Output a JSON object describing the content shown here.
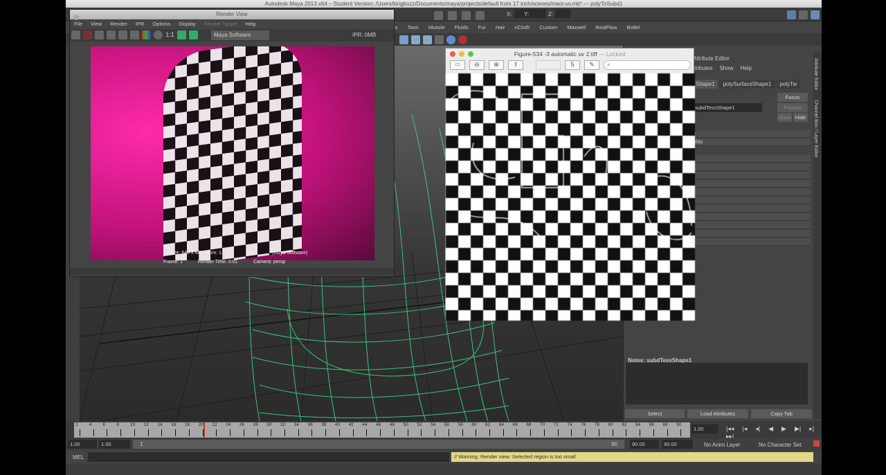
{
  "window_title": "Autodesk Maya 2013 x64 – Student Version: /Users/kingbuzz/Documents/maya/projects/default from 17 inch/scenes/maoi-uv.mb*  ---  polyToSubd1",
  "toolbar": {
    "x_label": "X:",
    "y_label": "Y:",
    "z_label": "Z:"
  },
  "shelf_tabs": [
    "cts",
    "Toon",
    "Muscle",
    "Fluids",
    "Fur",
    "Hair",
    "nCloth",
    "Custom",
    "Maxwell",
    "RealFlow",
    "Bullet"
  ],
  "render_view": {
    "title": "Render View",
    "menu": [
      "File",
      "View",
      "Render",
      "IPR",
      "Options",
      "Display",
      "Render Target",
      "Help"
    ],
    "ratio": "1:1",
    "renderer": "Maya Software",
    "ipr": "IPR: 0MB",
    "info_line1": "size: 640 x 480 zoom: 1.000",
    "info_renderer": "(Maya Software)",
    "frame": "Frame: 1",
    "render_time": "Render Time: 0:01",
    "camera": "Camera: persp"
  },
  "figure": {
    "title": "Figure-534 -3 automatic uv 2.tiff",
    "locked": "— Locked",
    "rotate": "5"
  },
  "attribute_editor": {
    "title": "Attribute Editor",
    "menu": [
      "ttributes",
      "Show",
      "Help"
    ],
    "tabs": [
      "Shape1",
      "polySurfaceShape1",
      "polyTw"
    ],
    "node_name": "subdTessShape1",
    "focus": "Focus",
    "presets": "Presets",
    "show": "Show",
    "hide": "Hide",
    "sections": [
      "s",
      "play"
    ],
    "notes": "Notes:  subdTessShape1",
    "buttons": [
      "Select",
      "Load Attributes",
      "Copy Tab"
    ]
  },
  "side_tabs": [
    "Attribute Editor",
    "Channel Box / Layer Editor"
  ],
  "timeline": {
    "ticks": [
      "2",
      "4",
      "6",
      "8",
      "10",
      "12",
      "14",
      "16",
      "18",
      "20",
      "22",
      "24",
      "26",
      "28",
      "30",
      "32",
      "34",
      "36",
      "38",
      "40",
      "42",
      "44",
      "46",
      "48",
      "50",
      "52",
      "54",
      "56",
      "58",
      "60",
      "62",
      "64",
      "66",
      "68",
      "70",
      "72",
      "74",
      "76",
      "78",
      "80",
      "82",
      "84",
      "86",
      "88",
      "90"
    ],
    "current_frame": "1.00",
    "playback": [
      "|◂◂",
      "|◂",
      "◂|",
      "◀",
      "▶",
      "▶|",
      "▸|",
      "▸▸|"
    ]
  },
  "range": {
    "start": "1.00",
    "inner_start": "1.00",
    "slider_start": "1",
    "slider_end": "90",
    "end": "90.00",
    "outer_end": "90.00",
    "anim_layer": "No Anim Layer",
    "char_set": "No Character Set"
  },
  "mel": {
    "label": "MEL",
    "warning": "// Warning: Render view: Selected region is too small"
  }
}
